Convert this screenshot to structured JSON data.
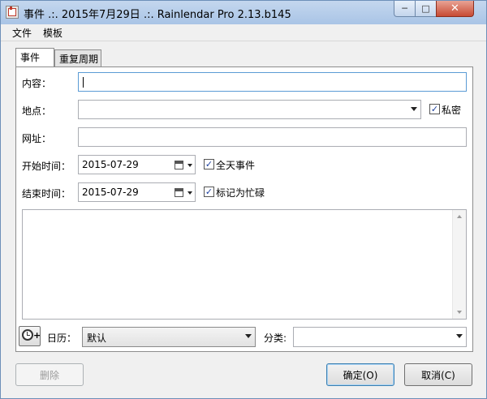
{
  "window": {
    "title": "事件 .:. 2015年7月29日 .:. Rainlendar Pro 2.13.b145",
    "min_glyph": "─",
    "max_glyph": "□",
    "close_glyph": "✕"
  },
  "menu": {
    "items": [
      "文件",
      "模板"
    ]
  },
  "tabs": [
    {
      "label": "事件",
      "active": true
    },
    {
      "label": "重复周期",
      "active": false
    }
  ],
  "form": {
    "content_label": "内容：",
    "content_value": "",
    "location_label": "地点：",
    "location_value": "",
    "private_label": "私密",
    "private_checked": true,
    "url_label": "网址：",
    "url_value": "",
    "start_label": "开始时间：",
    "start_date": "2015-07-29",
    "all_day_label": "全天事件",
    "all_day_checked": true,
    "end_label": "结束时间：",
    "end_date": "2015-07-29",
    "busy_label": "标记为忙碌",
    "busy_checked": true,
    "notes_value": "",
    "calendar_label": "日历：",
    "calendar_value": "默认",
    "category_label": "分类:",
    "category_value": ""
  },
  "buttons": {
    "delete": "删除",
    "ok": "确定(O)",
    "cancel": "取消(C)"
  },
  "check_glyph": "✓"
}
